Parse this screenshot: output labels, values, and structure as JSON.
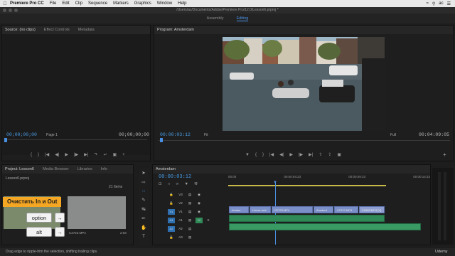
{
  "menubar": {
    "app": "Premiere Pro CC",
    "items": [
      "File",
      "Edit",
      "Clip",
      "Sequence",
      "Markers",
      "Graphics",
      "Window",
      "Help"
    ],
    "user": "ac"
  },
  "titlebar": {
    "path": "/Users/ac/Documents/Adobe/Premiere Pro/12.0/Lesson6.prproj *"
  },
  "workspaces": [
    {
      "label": "Assembly",
      "active": false
    },
    {
      "label": "Editing",
      "active": true
    }
  ],
  "source_panel": {
    "tabs": [
      "Source: (no clips)",
      "Effect Controls",
      "Metadata"
    ],
    "timecode_left": "00;00;00;00",
    "page": "Page 1",
    "timecode_right": "00;00;00;00"
  },
  "program_panel": {
    "tab": "Program: Amsterdam",
    "timecode_left": "00:00:03:12",
    "fit": "Fit",
    "quality": "Full",
    "timecode_right": "00:04:09:05"
  },
  "project_panel": {
    "tabs": [
      "Project: Lesson6",
      "Media Browser",
      "Libraries",
      "Info"
    ],
    "file": "Lesson6.prproj",
    "count": "21 Items",
    "item_label": "C2723.MP4",
    "item_duration": "2:03"
  },
  "timeline": {
    "tab": "Amsterdam",
    "timecode": "00:00:03:12",
    "ruler": [
      "00:00",
      "00:00:04:23",
      "00:00:09:23",
      "00:00:14:23"
    ],
    "tracks_video": [
      "V3",
      "V2",
      "V1"
    ],
    "tracks_audio": [
      "A1",
      "A2",
      "A3"
    ],
    "clips": [
      "Amster",
      "House and",
      "C2723.MP4",
      "Amsterd",
      "C2727.MP4",
      "C2683.MP4 [V]"
    ],
    "audio_label": "M"
  },
  "overlay": {
    "banner": "Очистить In и Out",
    "key1": "option",
    "key2": "alt"
  },
  "status": {
    "text": "Drag edge to ripple-trim the selection, shifting trailing clips."
  },
  "watermark": "Udemy",
  "colors": {
    "accent": "#4a90e2",
    "video_clip": "#7b8fc8",
    "audio_clip": "#2f8a58",
    "banner": "#f5a623"
  }
}
